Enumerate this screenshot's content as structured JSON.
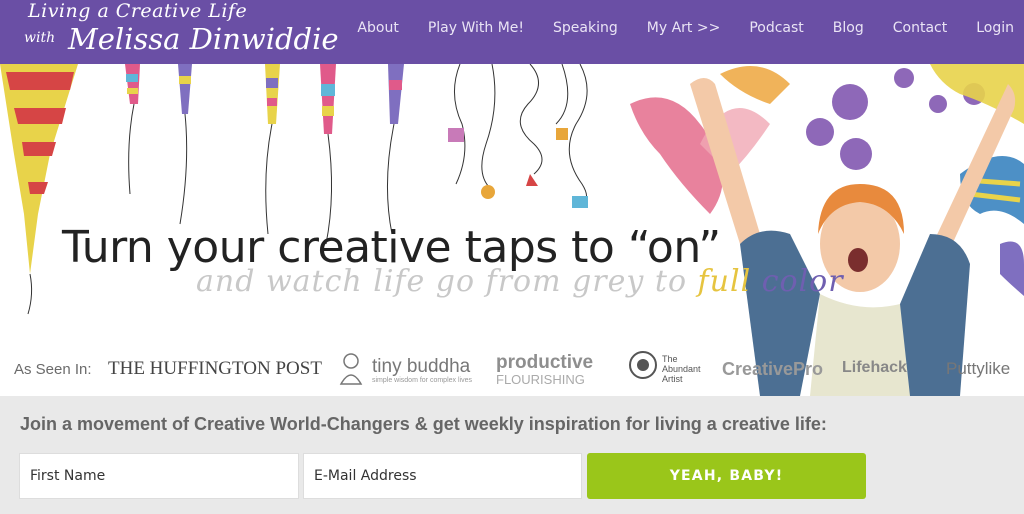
{
  "brand": {
    "line1": "Living a Creative Life",
    "line2": "with",
    "line3": "Melissa Dinwiddie"
  },
  "nav": [
    "About",
    "Play With Me!",
    "Speaking",
    "My Art >>",
    "Podcast",
    "Blog",
    "Contact",
    "Login"
  ],
  "hero": {
    "headline": "Turn your creative taps to “on”",
    "sub_part1": "and watch life go from grey to ",
    "sub_full": "full",
    "sub_space": " ",
    "sub_color": "color"
  },
  "seen_in": {
    "label": "As Seen In:",
    "huffington": "THE HUFFINGTON POST",
    "tiny_buddha": "tiny buddha",
    "tiny_buddha_tag": "simple wisdom for complex lives",
    "productive": "productive",
    "flourishing": "FLOURISHING",
    "abundant_artist": "The Abundant Artist",
    "creativepro": "CreativePro",
    "lifehack": "Lifehack",
    "puttylike": "Puttylike"
  },
  "signup": {
    "heading": "Join a movement of Creative World-Changers & get weekly inspiration for living a creative life:",
    "first_name_placeholder": "First Name",
    "email_placeholder": "E-Mail Address",
    "button": "YEAH, BABY!"
  },
  "colors": {
    "nav_bg": "#6a4fa5",
    "button_bg": "#9ac61a",
    "signup_bg": "#e9e9e9"
  }
}
